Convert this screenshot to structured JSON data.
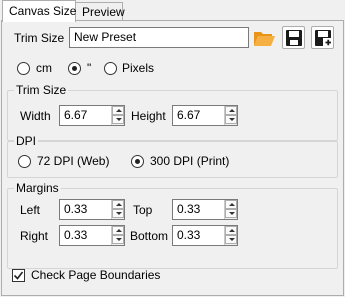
{
  "tabs": [
    {
      "label": "Canvas Size",
      "active": true
    },
    {
      "label": "Preview",
      "active": false
    }
  ],
  "trim": {
    "label": "Trim Size",
    "preset_value": "New Preset",
    "icons": [
      "folder-open-icon",
      "save-icon",
      "save-new-icon"
    ]
  },
  "units": {
    "options": [
      "cm",
      "\"",
      "Pixels"
    ],
    "selected": "\""
  },
  "trim_group": {
    "title": "Trim Size",
    "width_label": "Width",
    "width_value": "6.67",
    "height_label": "Height",
    "height_value": "6.67"
  },
  "dpi_group": {
    "title": "DPI",
    "options": [
      "72 DPI (Web)",
      "300 DPI (Print)"
    ],
    "selected": "300 DPI (Print)"
  },
  "margins_group": {
    "title": "Margins",
    "left_label": "Left",
    "left_value": "0.33",
    "top_label": "Top",
    "top_value": "0.33",
    "right_label": "Right",
    "right_value": "0.33",
    "bottom_label": "Bottom",
    "bottom_value": "0.33"
  },
  "check_page_boundaries": {
    "label": "Check Page Boundaries",
    "checked": true
  },
  "colors": {
    "background": "#f0f0f0",
    "border": "#adadad",
    "folder": "#f5a623",
    "save": "#1a1a1a"
  }
}
